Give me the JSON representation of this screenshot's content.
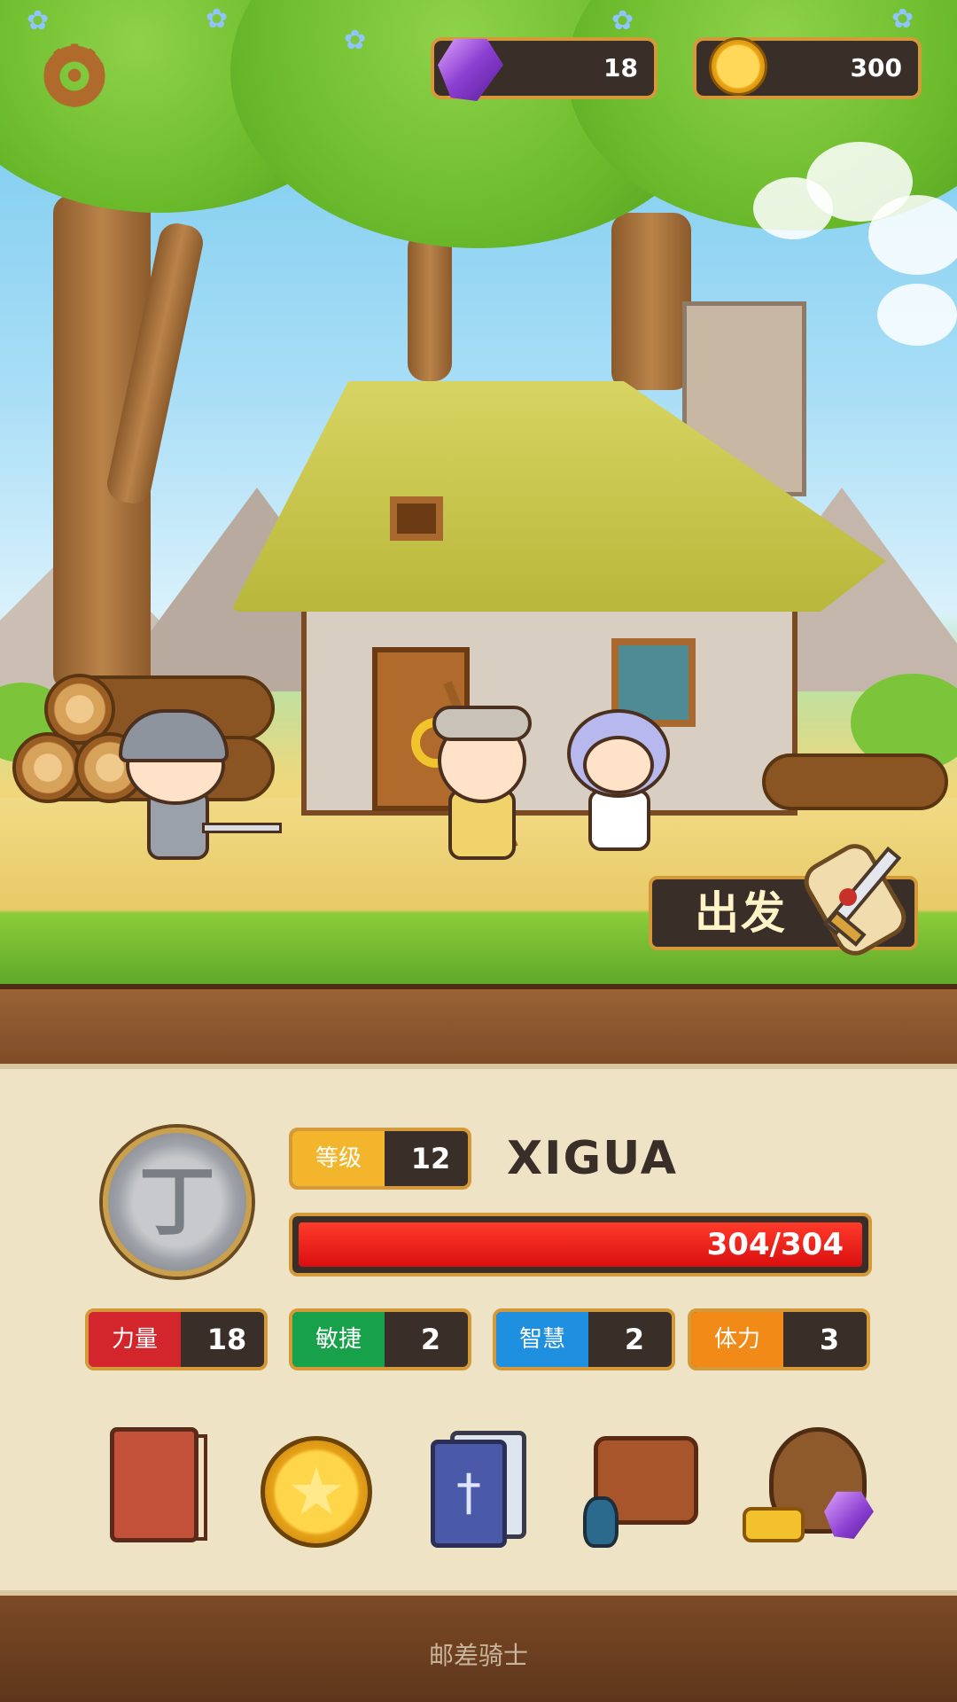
{
  "hud": {
    "gems": "18",
    "coins": "300",
    "settings_icon": "gear-icon",
    "gem_icon": "purple-gem-icon",
    "coin_icon": "gold-coin-icon"
  },
  "scene": {
    "depart_label": "出发",
    "depart_icon": "scroll-sword-icon"
  },
  "player": {
    "name": "XIGUA",
    "avatar_glyph": "丁",
    "level_label": "等级",
    "level": "12",
    "hp_text": "304/304",
    "hp_current": 304,
    "hp_max": 304
  },
  "stats": [
    {
      "label": "力量",
      "value": "18",
      "color": "#d3262c"
    },
    {
      "label": "敏捷",
      "value": "2",
      "color": "#16a14a"
    },
    {
      "label": "智慧",
      "value": "2",
      "color": "#1f8fe0"
    },
    {
      "label": "体力",
      "value": "3",
      "color": "#f28a18"
    }
  ],
  "menu": [
    {
      "icon": "journal-book-icon"
    },
    {
      "icon": "star-coin-icon"
    },
    {
      "icon": "card-deck-icon"
    },
    {
      "icon": "backpack-items-icon"
    },
    {
      "icon": "loot-bag-icon"
    }
  ],
  "footer": "邮差骑士"
}
